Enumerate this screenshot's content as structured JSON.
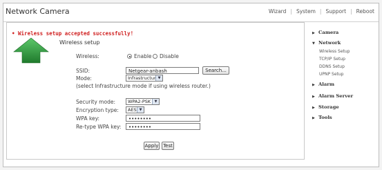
{
  "header": {
    "title": "Network Camera",
    "nav": [
      "Wizard",
      "System",
      "Support",
      "Reboot"
    ]
  },
  "message": "• Wireless setup accepted successfully!",
  "form": {
    "title": "Wireless setup",
    "wireless_label": "Wireless:",
    "enable_label": "Enable",
    "disable_label": "Disable",
    "wireless_enabled": true,
    "ssid_label": "SSID:",
    "ssid_value": "Netgear-anbash",
    "search_label": "Search...",
    "mode_label": "Mode:",
    "mode_value": "Infrastructure",
    "mode_note": "(select Infrastructure mode if using wireless router.)",
    "security_label": "Security mode:",
    "security_value": "WPA2-PSK",
    "encryption_label": "Encryption type:",
    "encryption_value": "AES",
    "wpa_key_label": "WPA key:",
    "wpa_key_value": "••••••••",
    "retype_label": "Re-type WPA key:",
    "retype_value": "••••••••",
    "apply_label": "Apply",
    "test_label": "Test"
  },
  "sidebar": {
    "items": [
      {
        "label": "Camera",
        "arrow": "▶"
      },
      {
        "label": "Network",
        "arrow": "▼"
      },
      {
        "label": "Alarm",
        "arrow": "▶"
      },
      {
        "label": "Alarm Server",
        "arrow": "▶"
      },
      {
        "label": "Storage",
        "arrow": "▶"
      },
      {
        "label": "Tools",
        "arrow": "▶"
      }
    ],
    "network_sub": [
      "Wireless Setup",
      "TCP/IP Setup",
      "DDNS Setup",
      "UPNP Setup"
    ]
  },
  "colors": {
    "message": "#d02020",
    "arrow_green": "#2e9b3a"
  },
  "icons": {
    "arrow": "up-arrow-icon",
    "collapsed": "triangle-right-icon",
    "expanded": "triangle-down-icon"
  }
}
